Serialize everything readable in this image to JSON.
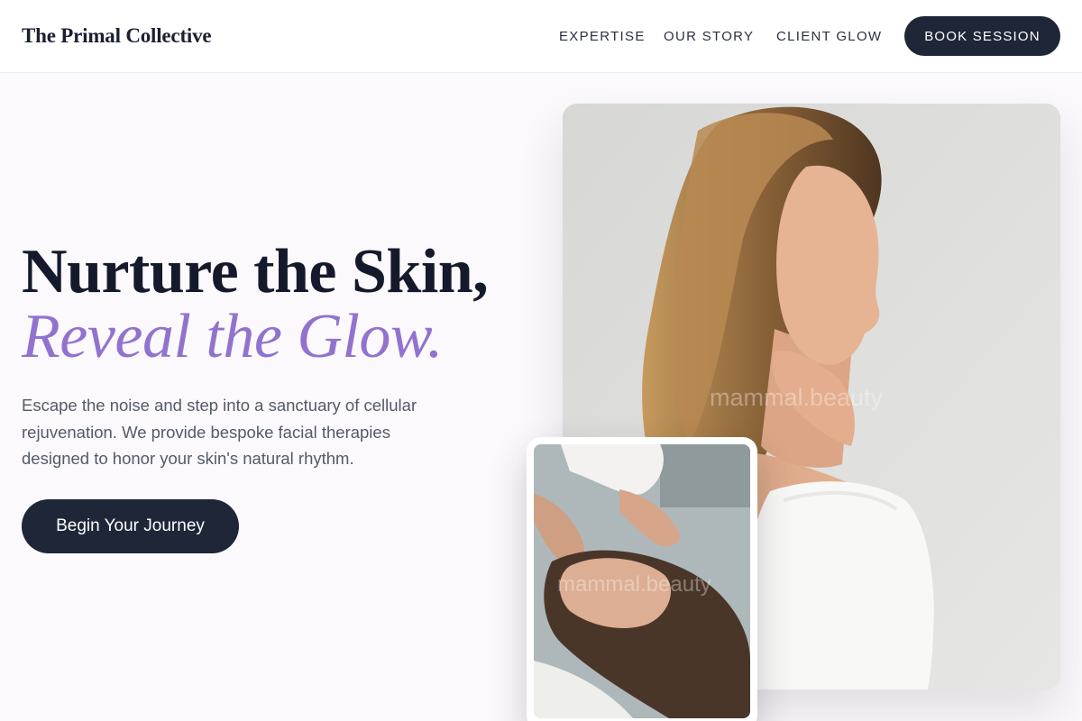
{
  "header": {
    "logo": "The Primal Collective",
    "nav": [
      "EXPERTISE",
      "OUR STORY",
      "CLIENT GLOW"
    ],
    "book_label": "BOOK SESSION"
  },
  "hero": {
    "headline_line1": "Nurture the Skin,",
    "headline_line2": "Reveal the Glow.",
    "intro": "Escape the noise and step into a sanctuary of cellular rejuvenation. We provide bespoke facial therapies designed to honor your skin's natural rhythm.",
    "cta_label": "Begin Your Journey"
  },
  "images": {
    "watermark": "mammal.beauty"
  },
  "colors": {
    "accent": "#9272cf",
    "primary": "#1e2638",
    "background": "#fbf9fc"
  }
}
